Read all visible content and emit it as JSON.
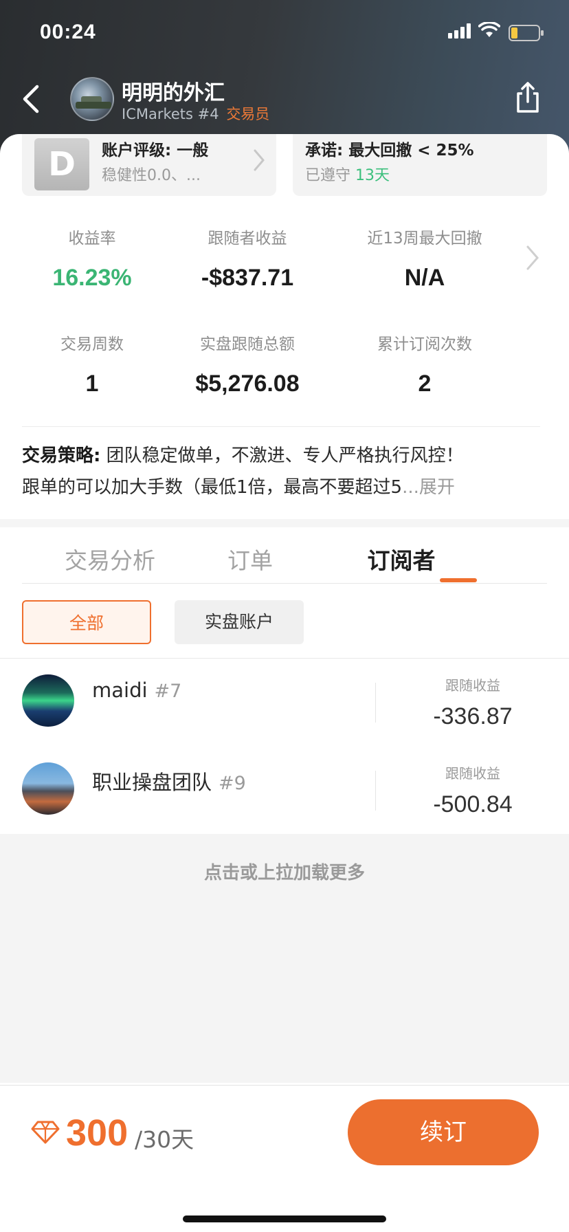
{
  "status_bar": {
    "time": "00:24"
  },
  "header": {
    "trader_name": "明明的外汇",
    "broker": "ICMarkets #4",
    "role_tag": "交易员"
  },
  "info_cards": {
    "rating": {
      "grade": "D",
      "title": "账户评级: 一般",
      "sub": "稳健性0.0、..."
    },
    "promise": {
      "title": "承诺: 最大回撤 < 25%",
      "sub_prefix": "已遵守",
      "sub_value": "13天"
    }
  },
  "stats": [
    {
      "label": "收益率",
      "value": "16.23%",
      "accent": "#3bb574"
    },
    {
      "label": "跟随者收益",
      "value": "-$837.71"
    },
    {
      "label": "近13周最大回撤",
      "value": "N/A"
    },
    {
      "label": "交易周数",
      "value": "1"
    },
    {
      "label": "实盘跟随总额",
      "value": "$5,276.08"
    },
    {
      "label": "累计订阅次数",
      "value": "2"
    }
  ],
  "strategy": {
    "label": "交易策略:",
    "line1": "团队稳定做单，不激进、专人严格执行风控！",
    "line2": "跟单的可以加大手数（最低1倍，最高不要超过5",
    "ellipsis": "...",
    "expand": "展开"
  },
  "tabs": [
    {
      "label": "交易分析",
      "active": false
    },
    {
      "label": "订单",
      "active": false
    },
    {
      "label": "订阅者",
      "active": true
    }
  ],
  "filters": [
    {
      "label": "全部",
      "active": true
    },
    {
      "label": "实盘账户",
      "active": false
    }
  ],
  "subscribers": [
    {
      "name": "maidi",
      "rank": "#7",
      "metric_label": "跟随收益",
      "metric_value": "-336.87",
      "avatar": "aurora"
    },
    {
      "name": "职业操盘团队",
      "rank": "#9",
      "metric_label": "跟随收益",
      "metric_value": "-500.84",
      "avatar": "city"
    }
  ],
  "load_more": "点击或上拉加载更多",
  "footer": {
    "price": "300",
    "period": "/30天",
    "renew_label": "续订",
    "accent": "#ec6f2f"
  }
}
